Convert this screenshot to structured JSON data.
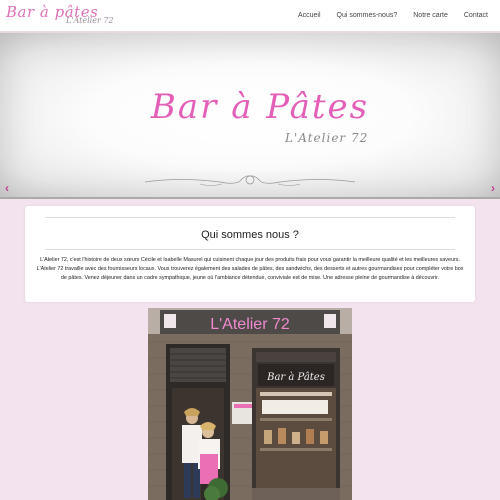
{
  "brand": {
    "name": "Bar à pâtes",
    "subtitle": "L'Atelier 72"
  },
  "nav": {
    "items": [
      {
        "label": "Accueil"
      },
      {
        "label": "Qui sommes-nous?"
      },
      {
        "label": "Notre carte"
      },
      {
        "label": "Contact"
      }
    ]
  },
  "carousel": {
    "title": "Bar à Pâtes",
    "subtitle": "L'Atelier 72",
    "prev_icon": "‹",
    "next_icon": "›"
  },
  "about": {
    "title": "Qui sommes nous ?",
    "text": "L'Atelier 72, c'est l'histoire de deux sœurs Cécile et Isabelle Masurel qui cuisinent chaque jour des produits frais pour vous garantir la meilleure qualité et les meilleures saveurs. L'Atelier 72 travaille avec des fournisseurs locaux. Vous trouverez également des salades de pâtes, des sandwichs, des desserts et autres gourmandises pour compléter votre box de pâtes. Venez déjeuner dans un cadre sympathique, jeune où l'ambiance détendue, conviviale est de mise. Une adresse pleine de gourmandise à découvrir."
  },
  "photo": {
    "sign_text": "L'Atelier 72",
    "window_sign": "Bar à Pâtes"
  },
  "colors": {
    "accent": "#e45fb8",
    "page_background": "#f3e3ee"
  }
}
